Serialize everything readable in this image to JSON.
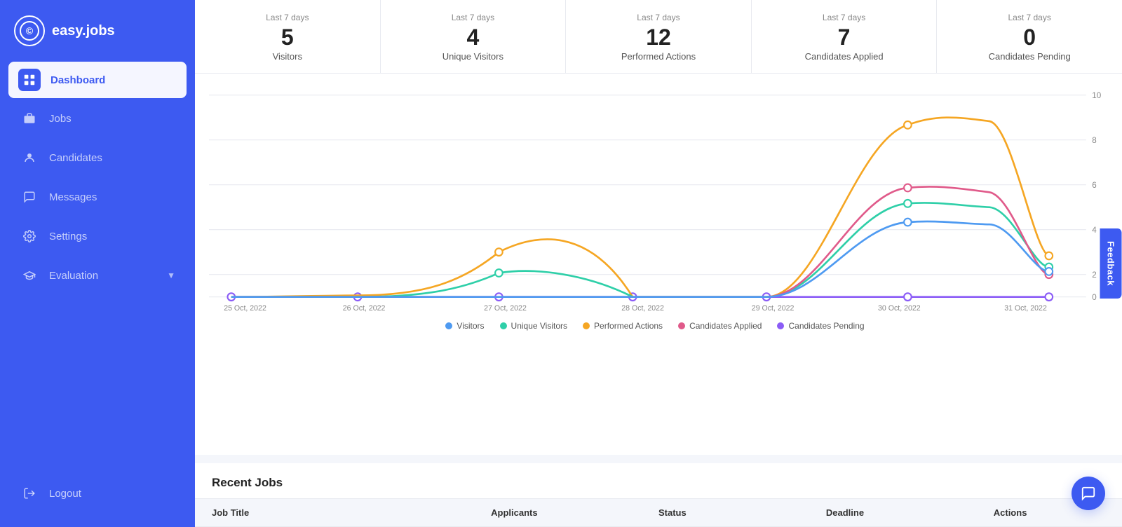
{
  "brand": {
    "name": "easy.jobs",
    "logo_symbol": "©"
  },
  "sidebar": {
    "items": [
      {
        "id": "dashboard",
        "label": "Dashboard",
        "icon": "🏠",
        "active": true
      },
      {
        "id": "jobs",
        "label": "Jobs",
        "icon": "💼",
        "active": false
      },
      {
        "id": "candidates",
        "label": "Candidates",
        "icon": "👤",
        "active": false
      },
      {
        "id": "messages",
        "label": "Messages",
        "icon": "💬",
        "active": false
      },
      {
        "id": "settings",
        "label": "Settings",
        "icon": "⚙",
        "active": false
      },
      {
        "id": "evaluation",
        "label": "Evaluation",
        "icon": "🎓",
        "active": false,
        "has_arrow": true
      }
    ],
    "logout": {
      "label": "Logout",
      "icon": "→"
    }
  },
  "stats": [
    {
      "period": "Last 7 days",
      "value": "5",
      "label": "Visitors"
    },
    {
      "period": "Last 7 days",
      "value": "4",
      "label": "Unique Visitors"
    },
    {
      "period": "Last 7 days",
      "value": "12",
      "label": "Performed Actions"
    },
    {
      "period": "Last 7 days",
      "value": "7",
      "label": "Candidates Applied"
    },
    {
      "period": "Last 7 days",
      "value": "0",
      "label": "Candidates Pending"
    }
  ],
  "chart": {
    "x_labels": [
      "25 Oct, 2022",
      "26 Oct, 2022",
      "27 Oct, 2022",
      "28 Oct, 2022",
      "29 Oct, 2022",
      "30 Oct, 2022",
      "31 Oct, 2022"
    ],
    "y_labels": [
      "0",
      "2",
      "4",
      "6",
      "8",
      "10"
    ],
    "legend": [
      {
        "label": "Visitors",
        "color": "#4e9af1"
      },
      {
        "label": "Unique Visitors",
        "color": "#2ecfa8"
      },
      {
        "label": "Performed Actions",
        "color": "#f5a623"
      },
      {
        "label": "Candidates Applied",
        "color": "#e05a8a"
      },
      {
        "label": "Candidates Pending",
        "color": "#8b5cf6"
      }
    ]
  },
  "recent_jobs": {
    "title": "Recent Jobs",
    "columns": [
      "Job Title",
      "Applicants",
      "Status",
      "Deadline",
      "Actions"
    ]
  },
  "feedback": {
    "label": "Feedback"
  },
  "chat": {
    "icon": "💬"
  }
}
